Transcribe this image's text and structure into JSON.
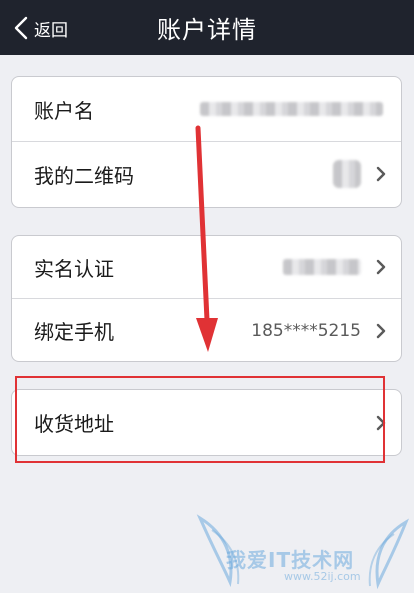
{
  "navbar": {
    "back_label": "返回",
    "title": "账户详情"
  },
  "groups": [
    {
      "rows": [
        {
          "label": "账户名",
          "value": "",
          "value_blurred": true,
          "has_chevron": false
        },
        {
          "label": "我的二维码",
          "value": "",
          "value_blurred": true,
          "has_chevron": true
        }
      ]
    },
    {
      "rows": [
        {
          "label": "实名认证",
          "value": "",
          "value_blurred": true,
          "has_chevron": true
        },
        {
          "label": "绑定手机",
          "value": "185****5215",
          "value_blurred": false,
          "has_chevron": true
        }
      ]
    },
    {
      "rows": [
        {
          "label": "收货地址",
          "value": "",
          "value_blurred": false,
          "has_chevron": true
        }
      ]
    }
  ],
  "watermark": {
    "text": "我爱IT技术网",
    "subtext": "www.52ij.com"
  },
  "colors": {
    "navbar_bg": "#1f232d",
    "page_bg": "#eeeff3",
    "annotation_red": "#e03235"
  },
  "icons": {
    "back": "chevron-left-icon",
    "row_arrow": "chevron-right-icon"
  }
}
